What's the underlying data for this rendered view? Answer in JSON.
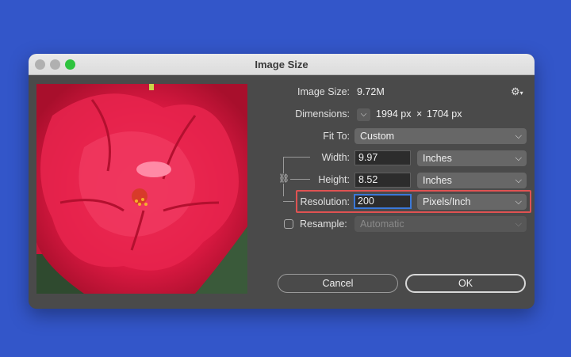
{
  "window": {
    "title": "Image Size"
  },
  "colors": {
    "accent": "#3b78d8",
    "highlight": "#e05252",
    "zoom": "#2ec33e"
  },
  "image_size": {
    "label": "Image Size:",
    "value": "9.72M"
  },
  "dimensions": {
    "label": "Dimensions:",
    "width_value": "1994 px",
    "times": "×",
    "height_value": "1704 px"
  },
  "fit_to": {
    "label": "Fit To:",
    "selected": "Custom"
  },
  "width": {
    "label": "Width:",
    "value": "9.97",
    "unit": "Inches"
  },
  "height": {
    "label": "Height:",
    "value": "8.52",
    "unit": "Inches"
  },
  "resolution": {
    "label": "Resolution:",
    "value": "200",
    "unit": "Pixels/Inch"
  },
  "resample": {
    "label": "Resample:",
    "selected": "Automatic",
    "checked": false
  },
  "buttons": {
    "cancel": "Cancel",
    "ok": "OK"
  },
  "icons": {
    "settings": "gear-icon",
    "link": "chain-link-icon",
    "chevron": "chevron-down-icon"
  }
}
